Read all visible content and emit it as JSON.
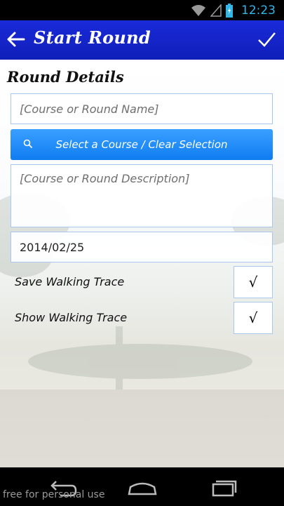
{
  "status_bar": {
    "time": "12:23"
  },
  "app_bar": {
    "title": "Start Round"
  },
  "section": {
    "title": "Round Details"
  },
  "form": {
    "name_placeholder": "[Course or Round Name]",
    "select_course_label": "Select a Course / Clear Selection",
    "description_placeholder": "[Course or Round Description]",
    "date_value": "2014/02/25",
    "save_trace_label": "Save Walking Trace",
    "save_trace_check": "√",
    "show_trace_label": "Show Walking Trace",
    "show_trace_check": "√"
  },
  "watermark": "free for personal use",
  "colors": {
    "app_bar": "#1a2ad9",
    "accent": "#0f7cf1",
    "status_time": "#33b5e5"
  }
}
